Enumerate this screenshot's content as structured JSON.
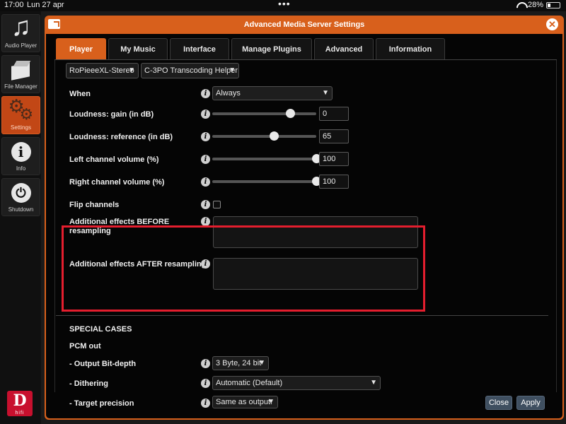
{
  "status_bar": {
    "time": "17:00",
    "date": "Lun 27 apr",
    "dots": "•••",
    "battery": "28%",
    "battery_level": 0.28
  },
  "sidebar": {
    "items": [
      {
        "label": "Audio Player",
        "icon": "music-note-icon"
      },
      {
        "label": "File Manager",
        "icon": "box-icon"
      },
      {
        "label": "Settings",
        "icon": "gear-icon",
        "active": true
      },
      {
        "label": "Info",
        "icon": "info-icon"
      },
      {
        "label": "Shutdown",
        "icon": "power-icon"
      }
    ],
    "logo": {
      "letter": "D",
      "text": "hifi"
    }
  },
  "dialog": {
    "title": "Advanced Media Server Settings",
    "close_icon": "close-icon",
    "tabs": [
      {
        "label": "Player",
        "active": true
      },
      {
        "label": "My Music"
      },
      {
        "label": "Interface"
      },
      {
        "label": "Manage Plugins"
      },
      {
        "label": "Advanced"
      },
      {
        "label": "Information"
      }
    ],
    "player_select": "RoPieeeXL-Stereo",
    "transcoder_select": "C-3PO Transcoding Helper",
    "settings": {
      "when": {
        "label": "When",
        "value": "Always"
      },
      "loudness_gain": {
        "label": "Loudness: gain (in dB)",
        "value": "0",
        "slider": 0.75
      },
      "loudness_ref": {
        "label": "Loudness: reference (in dB)",
        "value": "65",
        "slider": 0.59
      },
      "left_vol": {
        "label": "Left channel volume (%)",
        "value": "100",
        "slider": 1.0
      },
      "right_vol": {
        "label": "Right channel volume (%)",
        "value": "100",
        "slider": 1.0
      },
      "flip": {
        "label": "Flip channels",
        "checked": false
      },
      "effects_before": {
        "label": "Additional effects BEFORE resampling",
        "value": ""
      },
      "effects_after": {
        "label": "Additional effects AFTER resampling",
        "value": ""
      }
    },
    "special": {
      "heading": "SPECIAL CASES",
      "subheading": "PCM out",
      "bit_depth": {
        "label": "- Output Bit-depth",
        "value": "3 Byte, 24 bit"
      },
      "dithering": {
        "label": "- Dithering",
        "value": "Automatic (Default)"
      },
      "precision": {
        "label": "- Target precision",
        "value": "Same as output."
      }
    },
    "buttons": {
      "close": "Close",
      "apply": "Apply"
    },
    "highlight_color": "#e41e2e",
    "accent_color": "#d8601c"
  }
}
